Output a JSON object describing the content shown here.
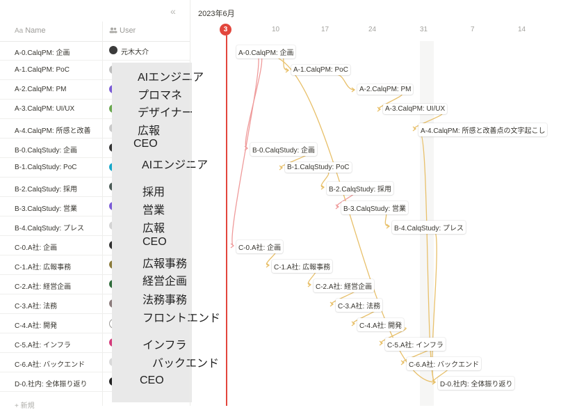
{
  "table": {
    "collapse_icon": "«",
    "columns": {
      "name": "Name",
      "name_icon": "Aa",
      "user": "User",
      "user_icon": "people-icon"
    },
    "new_row": "+ 新規",
    "rows": [
      {
        "name": "A-0.CalqPM: 企画",
        "user": "元木大介",
        "avatar_color": "#3b3b3b"
      },
      {
        "name": "A-1.CalqPM: PoC",
        "user": "",
        "avatar_color": "#bdbdbd"
      },
      {
        "name": "A-2.CalqPM: PM",
        "user": "",
        "avatar_color": "#7a5bd6"
      },
      {
        "name": "A-3.CalqPM: UI/UX",
        "user": "",
        "avatar_color": "#6aa84f"
      },
      {
        "name": "A-4.CalqPM: 所感と改善",
        "user": "",
        "avatar_color": "#c9c9c9"
      },
      {
        "name": "B-0.CalqStudy: 企画",
        "user": "",
        "avatar_color": "#333333"
      },
      {
        "name": "B-1.CalqStudy: PoC",
        "user": "",
        "avatar_color": "#17a7c9"
      },
      {
        "name": "B-2.CalqStudy: 採用",
        "user": "",
        "avatar_color": "#4a5a55"
      },
      {
        "name": "B-3.CalqStudy: 営業",
        "user": "",
        "avatar_color": "#7a5bd6"
      },
      {
        "name": "B-4.CalqStudy: プレス",
        "user": "",
        "avatar_color": "#d3d3d3"
      },
      {
        "name": "C-0.A社: 企画",
        "user": "",
        "avatar_color": "#2f2f2f"
      },
      {
        "name": "C-1.A社: 広報事務",
        "user": "",
        "avatar_color": "#8a7a3a"
      },
      {
        "name": "C-2.A社: 経営企画",
        "user": "",
        "avatar_color": "#2e6b3a"
      },
      {
        "name": "C-3.A社: 法務",
        "user": "",
        "avatar_color": "#8b7b7b"
      },
      {
        "name": "C-4.A社: 開発",
        "user": "",
        "avatar_color": "#ffffff"
      },
      {
        "name": "C-5.A社: インフラ",
        "user": "",
        "avatar_color": "#d43a7a"
      },
      {
        "name": "C-6.A社: バックエンド",
        "user": "",
        "avatar_color": "#d8d8d8"
      },
      {
        "name": "D-0.社内: 全体振り返り",
        "user": "",
        "avatar_color": "#222222"
      }
    ]
  },
  "overlay_labels": [
    {
      "text": "AIエンジニア"
    },
    {
      "text": "プロマネ"
    },
    {
      "text": "デザイナー"
    },
    {
      "text": "広報"
    },
    {
      "text": "CEO"
    },
    {
      "text": "AIエンジニア"
    },
    {
      "text": "採用"
    },
    {
      "text": "営業"
    },
    {
      "text": "広報"
    },
    {
      "text": "CEO"
    },
    {
      "text": "広報事務"
    },
    {
      "text": "経営企画"
    },
    {
      "text": "法務事務"
    },
    {
      "text": "フロントエンド"
    },
    {
      "text": "インフラ"
    },
    {
      "text": "バックエンド"
    },
    {
      "text": "CEO"
    }
  ],
  "timeline": {
    "month": "2023年6月",
    "today": "3",
    "days": [
      "10",
      "17",
      "24",
      "31",
      "7",
      "14"
    ],
    "accent_color": "#e2463c",
    "dependency_color": "#e8c06a",
    "blocked_color": "#ef9a9a",
    "items": [
      "A-0.CalqPM: 企画",
      "A-1.CalqPM: PoC",
      "A-2.CalqPM: PM",
      "A-3.CalqPM: UI/UX",
      "A-4.CalqPM: 所感と改善点の文字起こし",
      "B-0.CalqStudy: 企画",
      "B-1.CalqStudy: PoC",
      "B-2.CalqStudy: 採用",
      "B-3.CalqStudy: 営業",
      "B-4.CalqStudy: プレス",
      "C-0.A社: 企画",
      "C-1.A社: 広報事務",
      "C-2.A社: 経営企画",
      "C-3.A社: 法務",
      "C-4.A社: 開発",
      "C-5.A社: インフラ",
      "C-6.A社: バックエンド",
      "D-0.社内: 全体振り返り"
    ]
  }
}
